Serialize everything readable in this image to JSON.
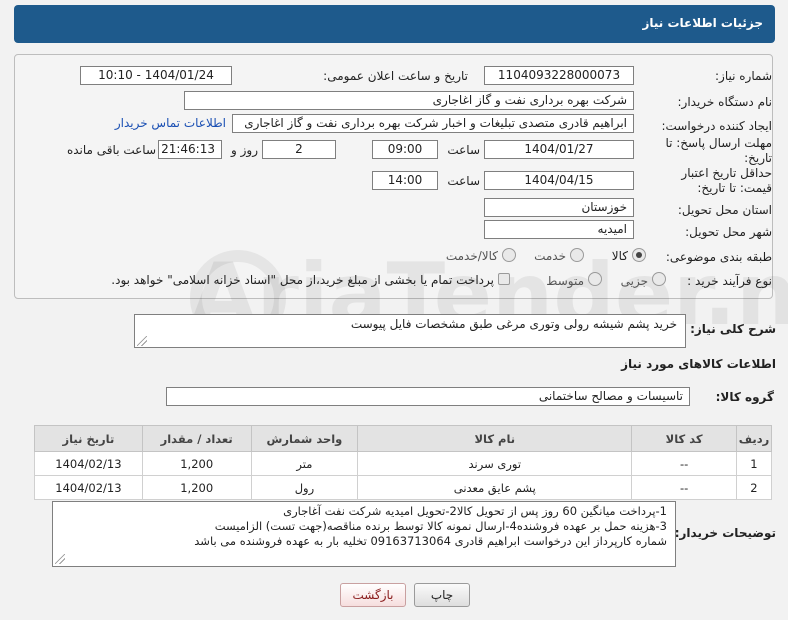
{
  "header": {
    "title": "جزئیات اطلاعات نیاز"
  },
  "form": {
    "need_number_label": "شماره نیاز:",
    "need_number_value": "1104093228000073",
    "announce_label": "تاریخ و ساعت اعلان عمومی:",
    "announce_value": "1404/01/24 - 10:10",
    "buyer_label": "نام دستگاه خریدار:",
    "buyer_value": "شرکت بهره برداری نفت و گاز اغاجاری",
    "creator_label": "ایجاد کننده درخواست:",
    "creator_value": "ابراهیم قادری متصدی تبلیغات و اخبار شرکت بهره برداری نفت و گاز اغاجاری",
    "contact_link": "اطلاعات تماس خریدار",
    "reply_deadline_label": "مهلت ارسال پاسخ: تا تاریخ:",
    "reply_date": "1404/01/27",
    "time_label": "ساعت",
    "reply_time": "09:00",
    "days_value": "2",
    "days_label": "روز و",
    "remaining_value": "21:46:13",
    "remaining_label": "ساعت باقی مانده",
    "price_deadline_label": "حداقل تاریخ اعتبار قیمت: تا تاریخ:",
    "price_date": "1404/04/15",
    "price_time": "14:00",
    "province_label": "استان محل تحویل:",
    "province_value": "خوزستان",
    "city_label": "شهر محل تحویل:",
    "city_value": "امیدیه",
    "category_label": "طبقه بندی موضوعی:",
    "category_options": [
      "کالا",
      "خدمت",
      "کالا/خدمت"
    ],
    "category_selected": "کالا",
    "process_label": "نوع فرآیند خرید :",
    "process_options": [
      "جزیی",
      "متوسط"
    ],
    "process_note": "پرداخت تمام یا بخشی از مبلغ خرید،از محل \"اسناد خزانه اسلامی\" خواهد بود."
  },
  "summary": {
    "label": "شرح کلی نیاز:",
    "value": "خرید پشم شیشه رولی وتوری مرغی طبق مشخصات فایل پیوست"
  },
  "goods": {
    "section_title": "اطلاعات کالاهای مورد نیاز",
    "group_label": "گروه کالا:",
    "group_value": "تاسیسات و مصالح ساختمانی",
    "columns": [
      "ردیف",
      "کد کالا",
      "نام کالا",
      "واحد شمارش",
      "تعداد / مقدار",
      "تاریخ نیاز"
    ],
    "rows": [
      {
        "row": "1",
        "code": "--",
        "name": "توری سرند",
        "unit": "متر",
        "qty": "1,200",
        "date": "1404/02/13"
      },
      {
        "row": "2",
        "code": "--",
        "name": "پشم عایق معدنی",
        "unit": "رول",
        "qty": "1,200",
        "date": "1404/02/13"
      }
    ]
  },
  "buyer_notes": {
    "label": "توضیحات خریدار:",
    "lines": [
      "1-پرداخت میانگین 60 روز پس از تحویل کالا2-تحویل امیدیه شرکت نفت آغاجاری",
      "3-هزینه حمل بر عهده فروشنده4-ارسال نمونه کالا توسط برنده مناقصه(جهت تست) الزامیست",
      "شماره کارپرداز این درخواست  ابراهیم قادری 09163713064 تخلیه بار به عهده فروشنده می باشد"
    ]
  },
  "buttons": {
    "print": "چاپ",
    "back": "بازگشت"
  }
}
